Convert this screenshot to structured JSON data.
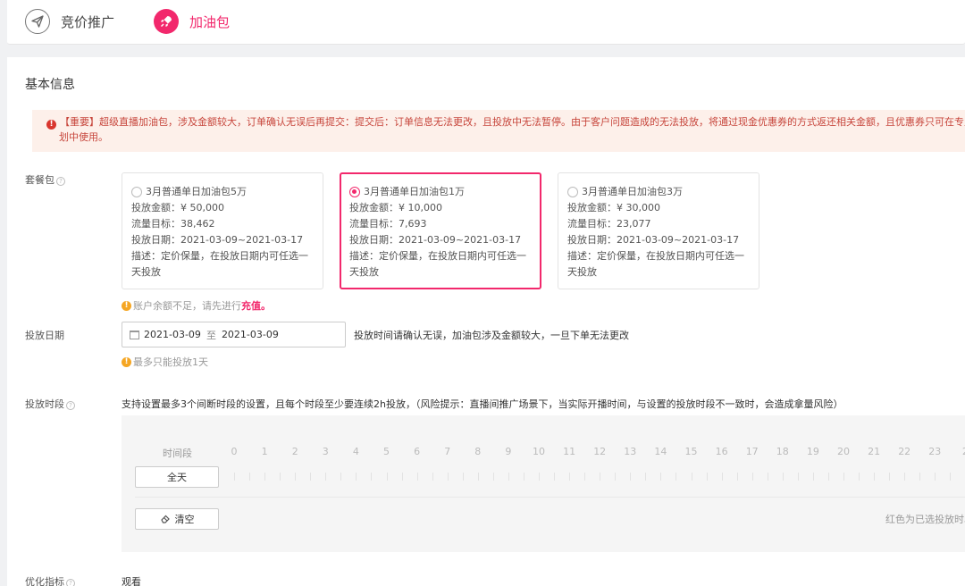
{
  "topbar": {
    "tabs": [
      {
        "label": "竞价推广",
        "icon": "send-icon"
      },
      {
        "label": "加油包",
        "icon": "rocket-icon"
      }
    ]
  },
  "basic_info": {
    "title": "基本信息",
    "notice": {
      "line1": "【重要】超级直播加油包，涉及金额较大，订单确认无误后再提交：提交后：订单信息无法更改，且投放中无法暂停。由于客户问题造成的无法投放，将通过现金优惠券的方式返还相关金额，且优惠券只可在专业版计",
      "line2": "划中使用。"
    }
  },
  "package": {
    "label": "套餐包",
    "items": [
      {
        "title": "3月普通单日加油包5万",
        "amount": "投放金额：¥ 50,000",
        "target": "流量目标：38,462",
        "dates": "投放日期：2021-03-09~2021-03-17",
        "desc": "描述：定价保量，在投放日期内可任选一天投放",
        "selected": false
      },
      {
        "title": "3月普通单日加油包1万",
        "amount": "投放金额：¥ 10,000",
        "target": "流量目标：7,693",
        "dates": "投放日期：2021-03-09~2021-03-17",
        "desc": "描述：定价保量，在投放日期内可任选一天投放",
        "selected": true
      },
      {
        "title": "3月普通单日加油包3万",
        "amount": "投放金额：¥ 30,000",
        "target": "流量目标：23,077",
        "dates": "投放日期：2021-03-09~2021-03-17",
        "desc": "描述：定价保量，在投放日期内可任选一天投放",
        "selected": false
      }
    ],
    "balance_hint": "账户余额不足，请先进行",
    "recharge_link": "充值。"
  },
  "date": {
    "label": "投放日期",
    "start": "2021-03-09",
    "separator": "至",
    "end": "2021-03-09",
    "note": "投放时间请确认无误，加油包涉及金额较大，一旦下单无法更改",
    "hint": "最多只能投放1天"
  },
  "time_slot": {
    "label": "投放时段",
    "description": "支持设置最多3个间断时段的设置，且每个时段至少要连续2h投放，（风险提示：直播间推广场景下，当实际开播时间，与设置的投放时段不一致时，会造成拿量风险）",
    "panel_label": "时间段",
    "hours": [
      "0",
      "1",
      "2",
      "3",
      "4",
      "5",
      "6",
      "7",
      "8",
      "9",
      "10",
      "11",
      "12",
      "13",
      "14",
      "15",
      "16",
      "17",
      "18",
      "19",
      "20",
      "21",
      "22",
      "23",
      "2"
    ],
    "all_day_label": "全天",
    "clear_label": "清空",
    "legend": "红色为已选投放时段"
  },
  "optimize": {
    "label": "优化指标",
    "value": "观看"
  },
  "colors": {
    "accent": "#f2286c",
    "warning": "#f5a623",
    "notice_bg": "#fdf0ea",
    "notice_text": "#c7463c"
  }
}
